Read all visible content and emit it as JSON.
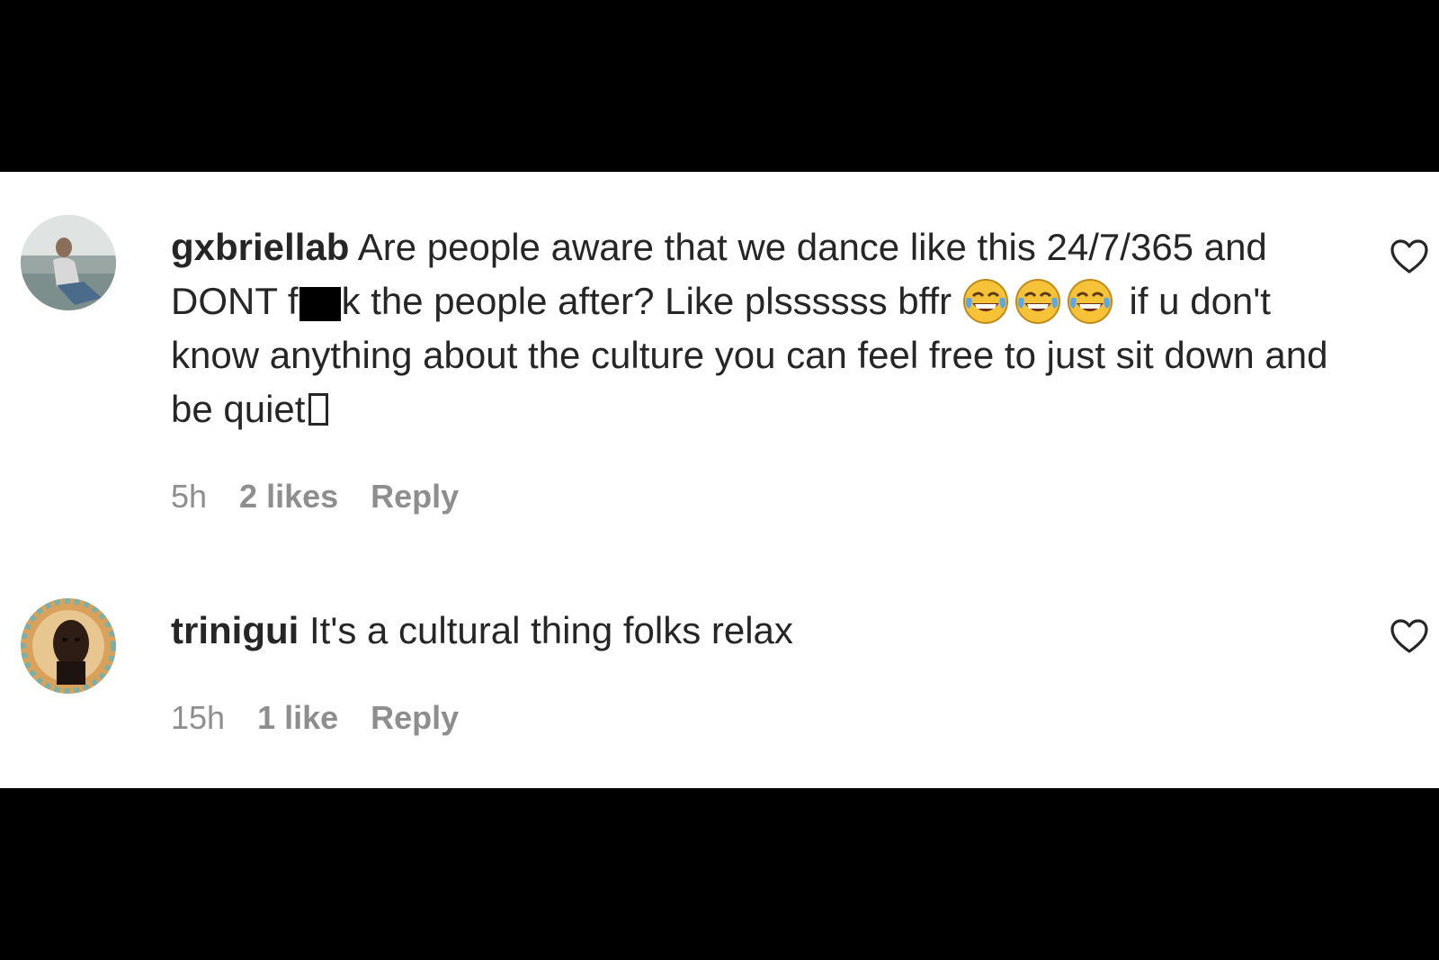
{
  "comments": [
    {
      "username": "gxbriellab",
      "text_part1": "Are people aware that we dance like this 24/7/365 and DONT f",
      "text_part2": "k the people after? Like plssssss bffr",
      "text_part3": "if u don't know anything about the culture you can feel free to just sit down and be quiet",
      "emoji": [
        "face-with-tears-of-joy-icon",
        "face-with-tears-of-joy-icon",
        "face-with-tears-of-joy-icon"
      ],
      "time": "5h",
      "likes": "2 likes",
      "reply_label": "Reply",
      "like_icon": "heart-outline-icon"
    },
    {
      "username": "trinigui",
      "text": "It's a cultural thing folks relax",
      "time": "15h",
      "likes": "1 like",
      "reply_label": "Reply",
      "like_icon": "heart-outline-icon"
    }
  ],
  "colors": {
    "text": "#262626",
    "meta": "#8e8e8e",
    "background": "#ffffff",
    "letterbox": "#000000"
  }
}
